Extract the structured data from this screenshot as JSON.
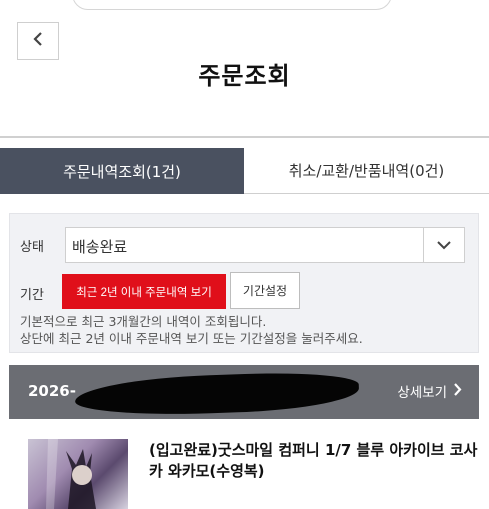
{
  "header": {
    "title": "주문조회",
    "back_icon": "chevron-left-icon"
  },
  "tabs": [
    {
      "label": "주문내역조회(1건)",
      "active": true
    },
    {
      "label": "취소/교환/반품내역(0건)",
      "active": false
    }
  ],
  "filter": {
    "status_label": "상태",
    "status_value": "배송완료",
    "period_label": "기간",
    "recent_button": "최근 2년 이내 주문내역 보기",
    "period_setting_button": "기간설정",
    "note_line1": "기본적으로 최근 3개월간의 내역이 조회됩니다.",
    "note_line2": "상단에 최근 2년 이내 주문내역 보기 또는 기간설정을 눌러주세요."
  },
  "order": {
    "date_visible": "2026-",
    "detail_link": "상세보기",
    "product_name": "(입고완료)굿스마일 컴퍼니 1/7 블루 아카이브 코사카 와카모(수영복)"
  },
  "colors": {
    "active_tab_bg": "#4a5160",
    "order_bar_bg": "#6b6d73",
    "primary_red": "#e00f1a",
    "filter_bg": "#f1f2f5"
  }
}
